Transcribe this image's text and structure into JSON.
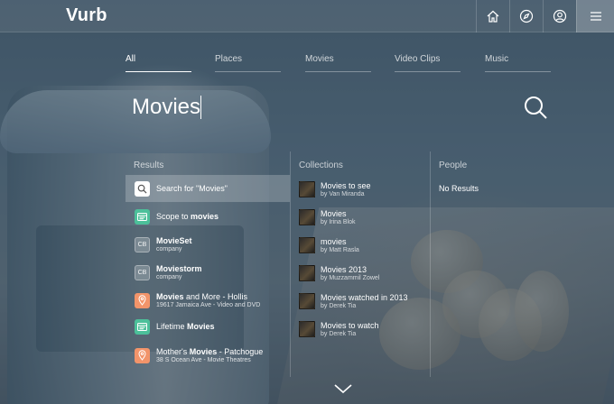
{
  "app": {
    "logo": "Vurb"
  },
  "header": {
    "nav": [
      {
        "icon": "home-icon"
      },
      {
        "icon": "compass-icon"
      },
      {
        "icon": "user-icon"
      },
      {
        "icon": "menu-icon"
      }
    ]
  },
  "tabs": [
    {
      "label": "All",
      "active": true
    },
    {
      "label": "Places"
    },
    {
      "label": "Movies"
    },
    {
      "label": "Video Clips"
    },
    {
      "label": "Music"
    }
  ],
  "search": {
    "value": "Movies",
    "icon": "search-icon"
  },
  "columns": {
    "results": "Results",
    "collections": "Collections",
    "people": "People"
  },
  "results": [
    {
      "icon": "search-icon",
      "pre": "Search for \"Movies\"",
      "bold": "",
      "post": "",
      "sub": ""
    },
    {
      "icon": "scope-icon",
      "pre": "Scope to ",
      "bold": "movies",
      "post": "",
      "sub": ""
    },
    {
      "icon": "company-icon",
      "pre": "",
      "bold": "MovieS",
      "post": "et",
      "sub": "company",
      "badge": "CB"
    },
    {
      "icon": "company-icon",
      "pre": "",
      "bold": "Movies",
      "post": "torm",
      "sub": "company",
      "badge": "CB"
    },
    {
      "icon": "location-pin-icon",
      "pre": "",
      "bold": "Movies",
      "post": " and More - Hollis",
      "sub": "19617 Jamaica Ave - Video and DVD"
    },
    {
      "icon": "scope-icon",
      "pre": "Lifetime ",
      "bold": "Movies",
      "post": "",
      "sub": ""
    },
    {
      "icon": "location-pin-icon",
      "pre": "Mother's ",
      "bold": "Movies",
      "post": " - Patchogue",
      "sub": "38 S Ocean Ave - Movie Theatres"
    }
  ],
  "collections": [
    {
      "title": "Movies to see",
      "by": "by Van Miranda"
    },
    {
      "title": "Movies",
      "by": "by Irina Blok"
    },
    {
      "title": "movies",
      "by": "by Matt Rasla"
    },
    {
      "title": "Movies 2013",
      "by": "by Muzzammil Zowel"
    },
    {
      "title": "Movies watched in 2013",
      "by": "by Derek Tia"
    },
    {
      "title": "Movies to watch",
      "by": "by Derek Tia"
    }
  ],
  "people": {
    "empty": "No Results"
  },
  "footer": {
    "icon": "chevron-down-icon"
  },
  "colors": {
    "scope": "#4cc09a",
    "place": "#f2946a",
    "overlay": "#283e52"
  }
}
